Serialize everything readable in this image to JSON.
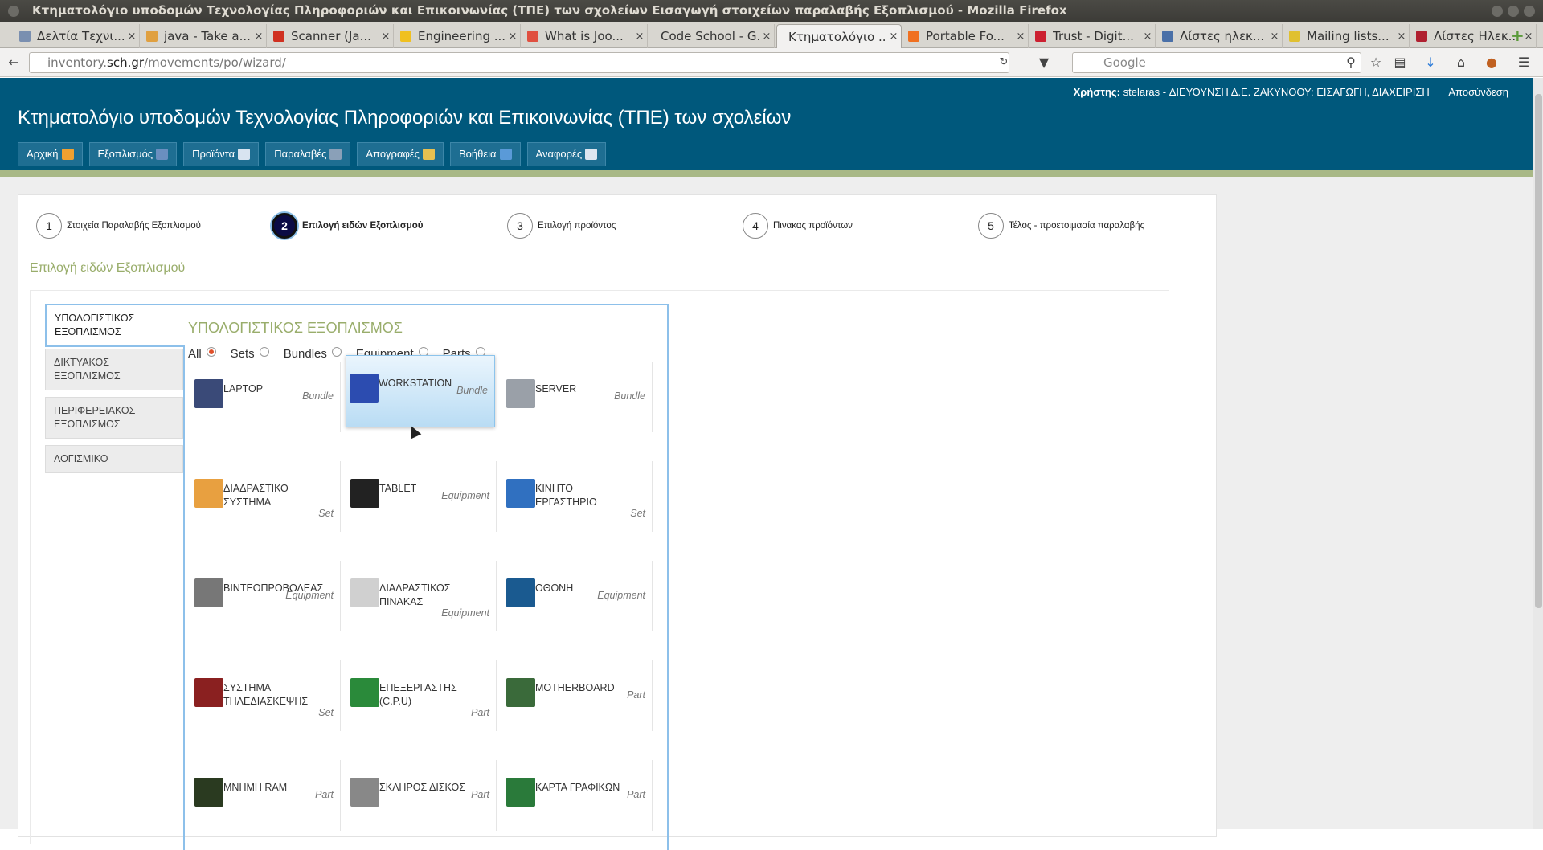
{
  "window": {
    "title": "Κτηματολόγιο υποδομών Τεχνολογίας Πληροφοριών και Επικοινωνίας (ΤΠΕ) των σχολείων Εισαγωγή στοιχείων παραλαβής Εξοπλισμού - Mozilla Firefox"
  },
  "tabs": [
    {
      "label": "Δελτία Τεχνι...",
      "icon_color": "#7a8fb0"
    },
    {
      "label": "java - Take a...",
      "icon_color": "#e0a040"
    },
    {
      "label": "Scanner (Ja...",
      "icon_color": "#d03020"
    },
    {
      "label": "Engineering ...",
      "icon_color": "#f0c020"
    },
    {
      "label": "What is Joo...",
      "icon_color": "#e05040"
    },
    {
      "label": "Code School - G...",
      "icon_color": ""
    },
    {
      "label": "Κτηματολόγιο ...",
      "icon_color": "",
      "active": true
    },
    {
      "label": "Portable Fo...",
      "icon_color": "#f07020"
    },
    {
      "label": "Trust - Digit...",
      "icon_color": "#cc2030"
    },
    {
      "label": "Λίστες ηλεκ...",
      "icon_color": "#4a70a8"
    },
    {
      "label": "Mailing lists...",
      "icon_color": "#e0c030"
    },
    {
      "label": "Λίστες Ηλεκ...",
      "icon_color": "#b02030"
    }
  ],
  "address": {
    "prefix": "inventory.",
    "domain": "sch.gr",
    "path": "/movements/po/wizard/"
  },
  "search": {
    "placeholder": "Google"
  },
  "site": {
    "title": "Κτηματολόγιο υποδομών Τεχνολογίας Πληροφοριών και Επικοινωνίας (ΤΠΕ) των σχολείων",
    "user_label": "Χρήστης:",
    "user_value": "stelaras - ΔΙΕΥΘΥΝΣΗ Δ.Ε. ΖΑΚΥΝΘΟΥ: ΕΙΣΑΓΩΓΗ, ΔΙΑΧΕΙΡΙΣΗ",
    "logout": "Αποσύνδεση"
  },
  "menu": [
    {
      "label": "Αρχική",
      "icon_color": "#f0a030"
    },
    {
      "label": "Εξοπλισμός",
      "icon_color": "#6a8fc0"
    },
    {
      "label": "Προϊόντα",
      "icon_color": "#d8e4f0"
    },
    {
      "label": "Παραλαβές",
      "icon_color": "#8aa0b8"
    },
    {
      "label": "Απογραφές",
      "icon_color": "#e8c050"
    },
    {
      "label": "Βοήθεια",
      "icon_color": "#5a9ad8"
    },
    {
      "label": "Αναφορές",
      "icon_color": "#dde6f0"
    }
  ],
  "steps": [
    {
      "num": "1",
      "label": "Στοιχεία Παραλαβής Εξοπλισμού"
    },
    {
      "num": "2",
      "label": "Επιλογή ειδών Εξοπλισμού",
      "active": true
    },
    {
      "num": "3",
      "label": "Επιλογή προϊόντος"
    },
    {
      "num": "4",
      "label": "Πινακας προϊόντων"
    },
    {
      "num": "5",
      "label": "Τέλος - προετοιμασία παραλαβής"
    }
  ],
  "section_title": "Επιλογή ειδών Εξοπλισμού",
  "categories": [
    {
      "label": "ΥΠΟΛΟΓΙΣΤΙΚΟΣ ΕΞΟΠΛΙΣΜΟΣ",
      "active": true
    },
    {
      "label": "ΔΙΚΤΥΑΚΟΣ ΕΞΟΠΛΙΣΜΟΣ"
    },
    {
      "label": "ΠΕΡΙΦΕΡΕΙΑΚΟΣ ΕΞΟΠΛΙΣΜΟΣ"
    },
    {
      "label": "ΛΟΓΙΣΜΙΚΟ"
    }
  ],
  "equipment_title": "ΥΠΟΛΟΓΙΣΤΙΚΟΣ ΕΞΟΠΛΙΣΜΟΣ",
  "filters": [
    {
      "label": "All",
      "selected": true
    },
    {
      "label": "Sets"
    },
    {
      "label": "Bundles"
    },
    {
      "label": "Equipment"
    },
    {
      "label": "Parts"
    }
  ],
  "items": [
    {
      "name": "LAPTOP",
      "type": "Bundle",
      "color": "#3a4a78"
    },
    {
      "name": "WORKSTATION",
      "type": "Bundle",
      "color": "#2c4cb0",
      "highlighted": true
    },
    {
      "name": "SERVER",
      "type": "Bundle",
      "color": "#9aa0a8"
    },
    {
      "name": "ΔΙΑΔΡΑΣΤΙΚΟ ΣΥΣΤΗΜΑ",
      "type": "Set",
      "color": "#e8a040"
    },
    {
      "name": "TABLET",
      "type": "Equipment",
      "color": "#222"
    },
    {
      "name": "ΚΙΝΗΤΟ ΕΡΓΑΣΤΗΡΙΟ",
      "type": "Set",
      "color": "#3070c0"
    },
    {
      "name": "ΒΙΝΤΕΟΠΡΟΒΟΛΕΑΣ",
      "type": "Equipment",
      "color": "#777"
    },
    {
      "name": "ΔΙΑΔΡΑΣΤΙΚΟΣ ΠΙΝΑΚΑΣ",
      "type": "Equipment",
      "color": "#d0d0d0"
    },
    {
      "name": "ΟΘΟΝΗ",
      "type": "Equipment",
      "color": "#1a5a90"
    },
    {
      "name": "ΣΥΣΤΗΜΑ ΤΗΛΕΔΙΑΣΚΕΨΗΣ",
      "type": "Set",
      "color": "#8a2020"
    },
    {
      "name": "ΕΠΕΞΕΡΓΑΣΤΗΣ (C.P.U)",
      "type": "Part",
      "color": "#2a8a3a"
    },
    {
      "name": "MOTHERBOARD",
      "type": "Part",
      "color": "#3a6a3a"
    },
    {
      "name": "ΜΝΗΜΗ RAM",
      "type": "Part",
      "color": "#2a3a20"
    },
    {
      "name": "ΣΚΛΗΡΟΣ ΔΙΣΚΟΣ",
      "type": "Part",
      "color": "#888"
    },
    {
      "name": "ΚΑΡΤΑ ΓΡΑΦΙΚΩΝ",
      "type": "Part",
      "color": "#2a7a3a"
    }
  ]
}
